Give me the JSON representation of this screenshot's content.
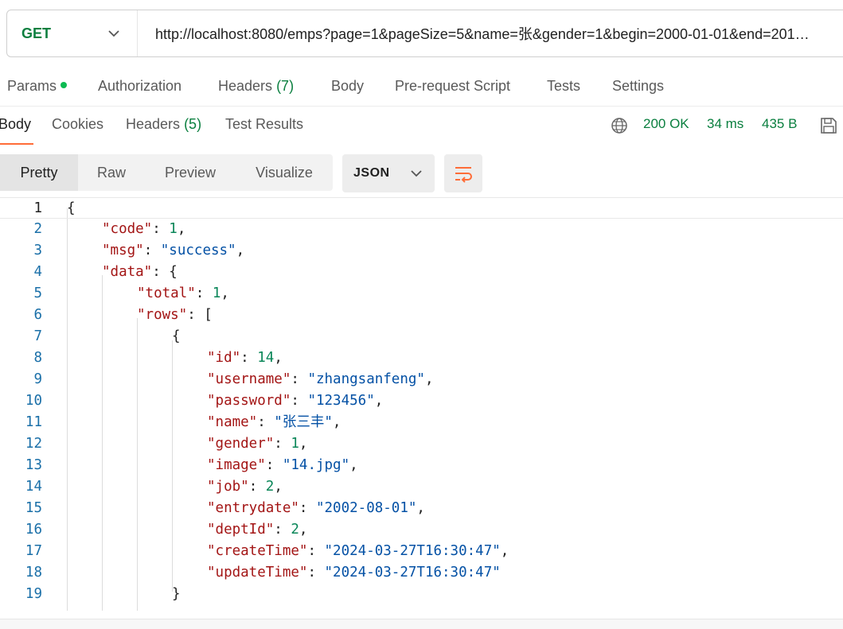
{
  "request": {
    "method": "GET",
    "url": "http://localhost:8080/emps?page=1&pageSize=5&name=张&gender=1&begin=2000-01-01&end=201…"
  },
  "request_tabs": [
    {
      "label": "Params",
      "count": ""
    },
    {
      "label": "Authorization",
      "count": ""
    },
    {
      "label": "Headers",
      "count": "(7)"
    },
    {
      "label": "Body",
      "count": ""
    },
    {
      "label": "Pre-request Script",
      "count": ""
    },
    {
      "label": "Tests",
      "count": ""
    },
    {
      "label": "Settings",
      "count": ""
    }
  ],
  "response_tabs": [
    {
      "label": "Body",
      "count": ""
    },
    {
      "label": "Cookies",
      "count": ""
    },
    {
      "label": "Headers",
      "count": "(5)"
    },
    {
      "label": "Test Results",
      "count": ""
    }
  ],
  "response_status": {
    "status": "200 OK",
    "time": "34 ms",
    "size": "435 B"
  },
  "view_modes": [
    "Pretty",
    "Raw",
    "Preview",
    "Visualize"
  ],
  "format": "JSON",
  "icons": {
    "method_dropdown": "chevron-down-icon",
    "globe": "globe-icon",
    "save": "save-icon",
    "format_dropdown": "chevron-down-icon",
    "wrap": "wrap-lines-icon"
  },
  "code_lines": [
    {
      "num": "1",
      "tokens": [
        {
          "t": "{",
          "c": "p"
        }
      ]
    },
    {
      "num": "2",
      "tokens": [
        {
          "t": "\"code\"",
          "c": "k"
        },
        {
          "t": ": ",
          "c": "p"
        },
        {
          "t": "1",
          "c": "n"
        },
        {
          "t": ",",
          "c": "p"
        }
      ]
    },
    {
      "num": "3",
      "tokens": [
        {
          "t": "\"msg\"",
          "c": "k"
        },
        {
          "t": ": ",
          "c": "p"
        },
        {
          "t": "\"success\"",
          "c": "s"
        },
        {
          "t": ",",
          "c": "p"
        }
      ]
    },
    {
      "num": "4",
      "tokens": [
        {
          "t": "\"data\"",
          "c": "k"
        },
        {
          "t": ": {",
          "c": "p"
        }
      ]
    },
    {
      "num": "5",
      "tokens": [
        {
          "t": "\"total\"",
          "c": "k"
        },
        {
          "t": ": ",
          "c": "p"
        },
        {
          "t": "1",
          "c": "n"
        },
        {
          "t": ",",
          "c": "p"
        }
      ]
    },
    {
      "num": "6",
      "tokens": [
        {
          "t": "\"rows\"",
          "c": "k"
        },
        {
          "t": ": [",
          "c": "p"
        }
      ]
    },
    {
      "num": "7",
      "tokens": [
        {
          "t": "{",
          "c": "p"
        }
      ]
    },
    {
      "num": "8",
      "tokens": [
        {
          "t": "\"id\"",
          "c": "k"
        },
        {
          "t": ": ",
          "c": "p"
        },
        {
          "t": "14",
          "c": "n"
        },
        {
          "t": ",",
          "c": "p"
        }
      ]
    },
    {
      "num": "9",
      "tokens": [
        {
          "t": "\"username\"",
          "c": "k"
        },
        {
          "t": ": ",
          "c": "p"
        },
        {
          "t": "\"zhangsanfeng\"",
          "c": "s"
        },
        {
          "t": ",",
          "c": "p"
        }
      ]
    },
    {
      "num": "10",
      "tokens": [
        {
          "t": "\"password\"",
          "c": "k"
        },
        {
          "t": ": ",
          "c": "p"
        },
        {
          "t": "\"123456\"",
          "c": "s"
        },
        {
          "t": ",",
          "c": "p"
        }
      ]
    },
    {
      "num": "11",
      "tokens": [
        {
          "t": "\"name\"",
          "c": "k"
        },
        {
          "t": ": ",
          "c": "p"
        },
        {
          "t": "\"张三丰\"",
          "c": "s"
        },
        {
          "t": ",",
          "c": "p"
        }
      ]
    },
    {
      "num": "12",
      "tokens": [
        {
          "t": "\"gender\"",
          "c": "k"
        },
        {
          "t": ": ",
          "c": "p"
        },
        {
          "t": "1",
          "c": "n"
        },
        {
          "t": ",",
          "c": "p"
        }
      ]
    },
    {
      "num": "13",
      "tokens": [
        {
          "t": "\"image\"",
          "c": "k"
        },
        {
          "t": ": ",
          "c": "p"
        },
        {
          "t": "\"14.jpg\"",
          "c": "s"
        },
        {
          "t": ",",
          "c": "p"
        }
      ]
    },
    {
      "num": "14",
      "tokens": [
        {
          "t": "\"job\"",
          "c": "k"
        },
        {
          "t": ": ",
          "c": "p"
        },
        {
          "t": "2",
          "c": "n"
        },
        {
          "t": ",",
          "c": "p"
        }
      ]
    },
    {
      "num": "15",
      "tokens": [
        {
          "t": "\"entrydate\"",
          "c": "k"
        },
        {
          "t": ": ",
          "c": "p"
        },
        {
          "t": "\"2002-08-01\"",
          "c": "s"
        },
        {
          "t": ",",
          "c": "p"
        }
      ]
    },
    {
      "num": "16",
      "tokens": [
        {
          "t": "\"deptId\"",
          "c": "k"
        },
        {
          "t": ": ",
          "c": "p"
        },
        {
          "t": "2",
          "c": "n"
        },
        {
          "t": ",",
          "c": "p"
        }
      ]
    },
    {
      "num": "17",
      "tokens": [
        {
          "t": "\"createTime\"",
          "c": "k"
        },
        {
          "t": ": ",
          "c": "p"
        },
        {
          "t": "\"2024-03-27T16:30:47\"",
          "c": "s"
        },
        {
          "t": ",",
          "c": "p"
        }
      ]
    },
    {
      "num": "18",
      "tokens": [
        {
          "t": "\"updateTime\"",
          "c": "k"
        },
        {
          "t": ": ",
          "c": "p"
        },
        {
          "t": "\"2024-03-27T16:30:47\"",
          "c": "s"
        }
      ]
    },
    {
      "num": "19",
      "tokens": [
        {
          "t": "}",
          "c": "p"
        }
      ]
    }
  ]
}
